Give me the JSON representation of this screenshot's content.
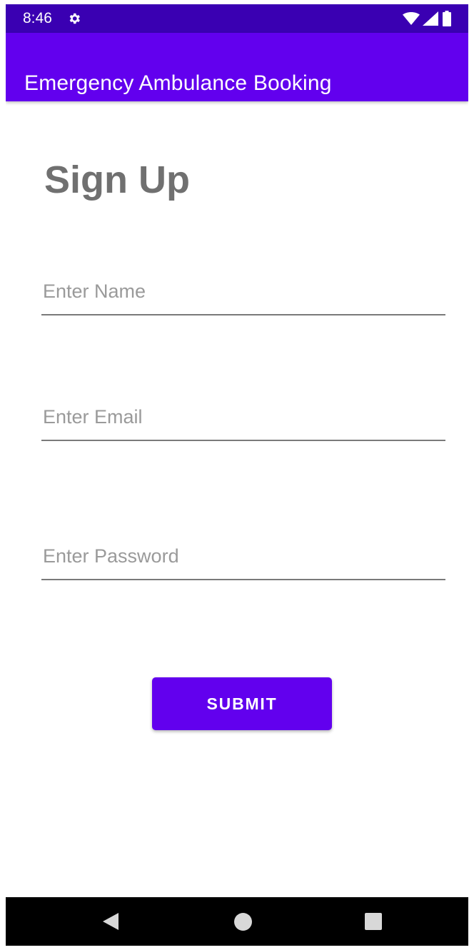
{
  "status_bar": {
    "time": "8:46",
    "icons": [
      "gear-icon",
      "wifi-icon",
      "signal-icon",
      "battery-icon"
    ],
    "background": "#3a00b2"
  },
  "app_bar": {
    "title": "Emergency Ambulance Booking",
    "background": "#6200ee"
  },
  "form": {
    "heading": "Sign Up",
    "name_placeholder": "Enter Name",
    "name_value": "",
    "email_placeholder": "Enter Email",
    "email_value": "",
    "password_placeholder": "Enter Password",
    "password_value": "",
    "submit_label": "SUBMIT",
    "accent": "#6200ee"
  },
  "nav_bar": {
    "icons": [
      "back-icon",
      "home-icon",
      "recents-icon"
    ]
  }
}
